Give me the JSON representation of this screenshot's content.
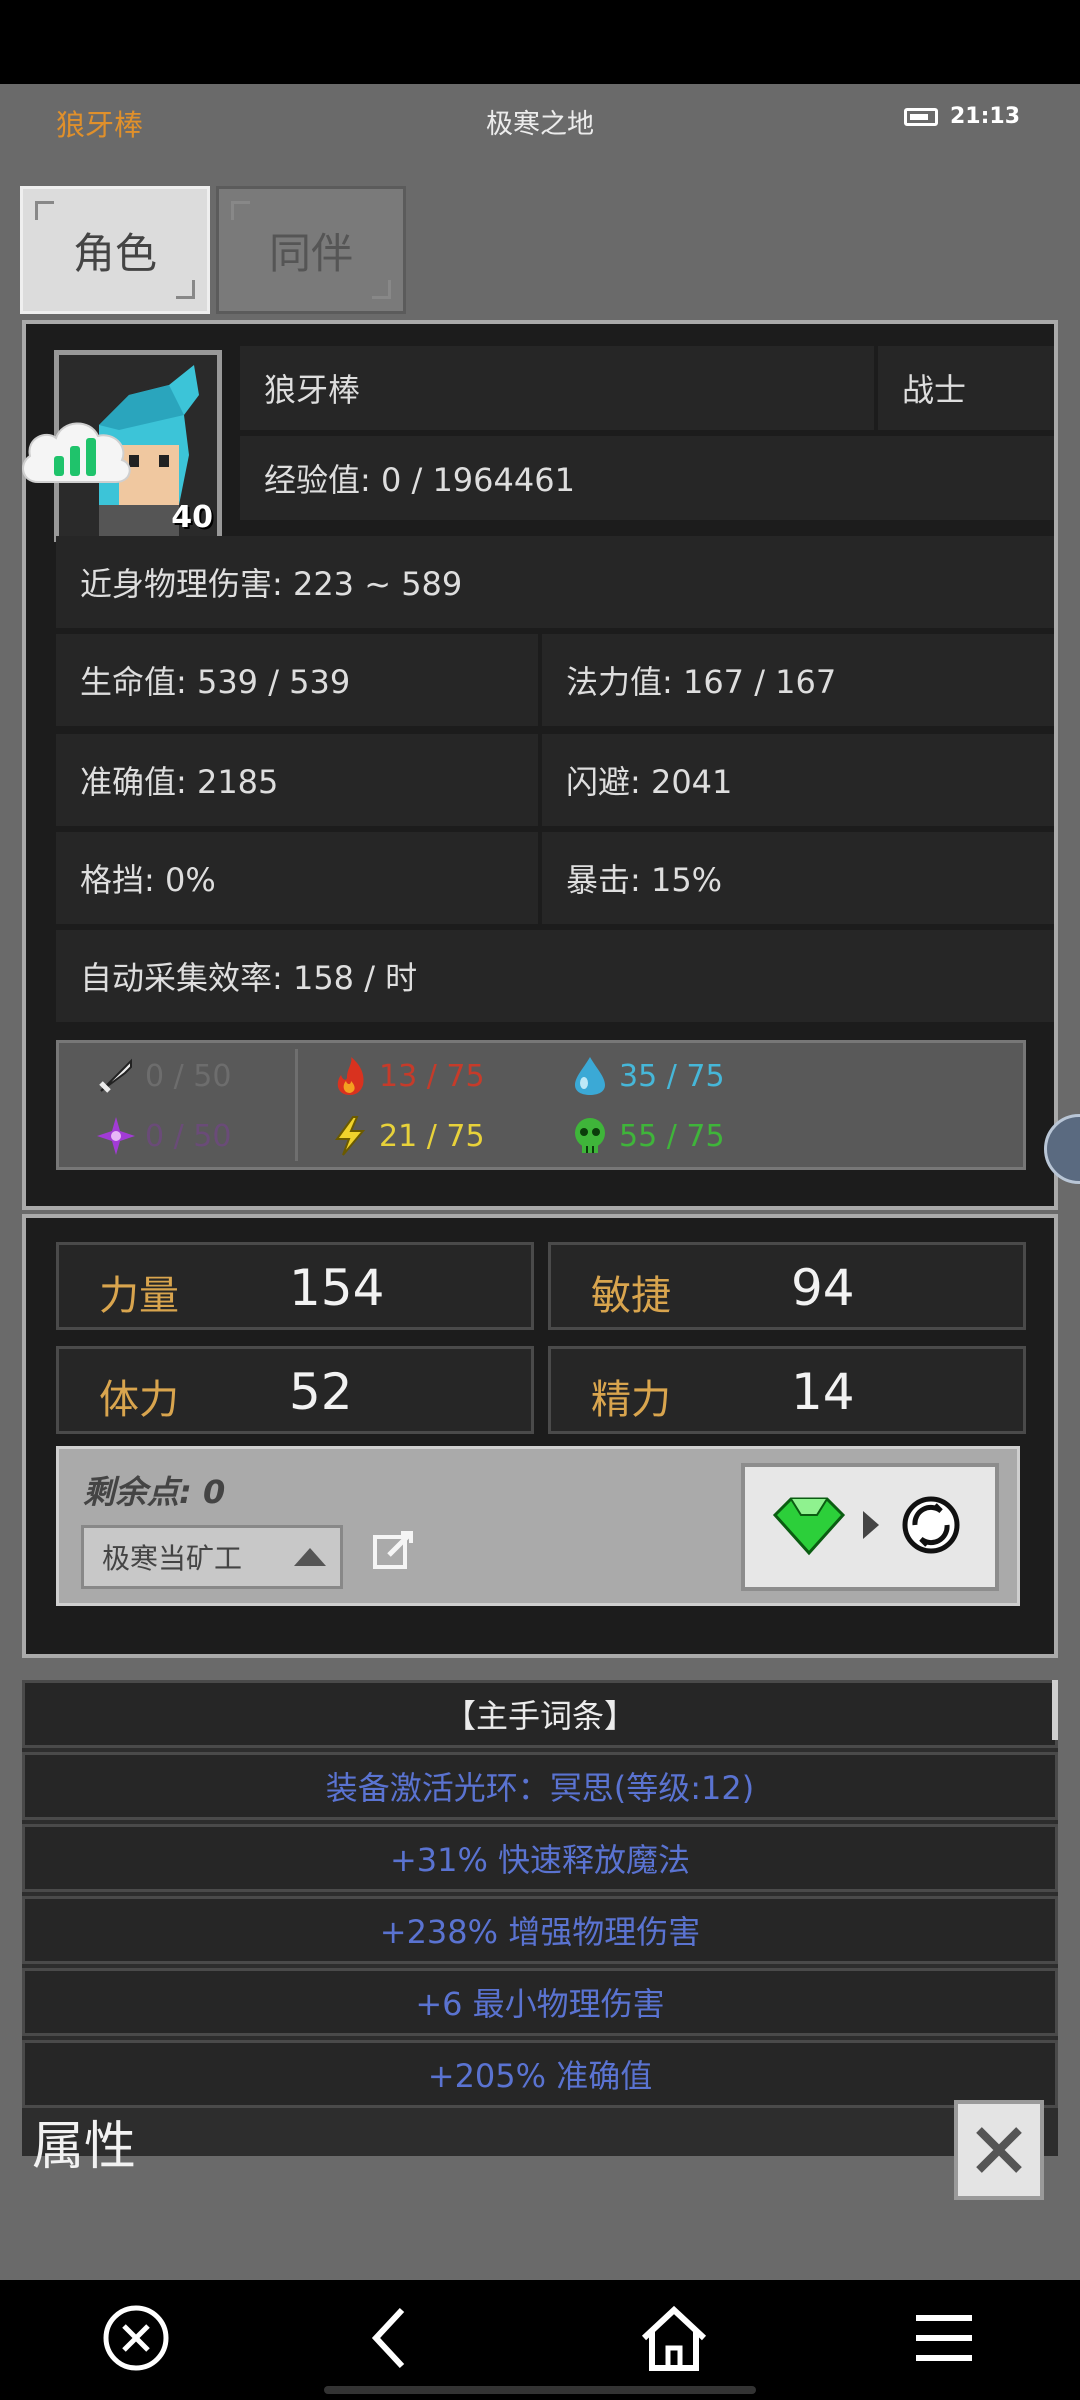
{
  "status_bar": {
    "weapon": "狼牙棒",
    "location": "极寒之地",
    "time": "21:13"
  },
  "tabs": [
    {
      "label": "角色",
      "active": true
    },
    {
      "label": "同伴",
      "active": false
    }
  ],
  "character": {
    "name": "狼牙棒",
    "class": "战士",
    "level": "40",
    "exp": "经验值: 0 / 1964461",
    "melee_damage": "近身物理伤害: 223 ~ 589",
    "hp": "生命值: 539 / 539",
    "mp": "法力值: 167 / 167",
    "accuracy": "准确值: 2185",
    "dodge": "闪避: 2041",
    "block": "格挡: 0%",
    "crit": "暴击: 15%",
    "gather_rate": "自动采集效率: 158 / 时"
  },
  "resistances": [
    {
      "icon": "sword-icon",
      "value": "0 / 50",
      "color": "#6d6d6d"
    },
    {
      "icon": "fire-icon",
      "value": "13 / 75",
      "color": "#c63b2a"
    },
    {
      "icon": "water-drop-icon",
      "value": "35 / 75",
      "color": "#46b7d9"
    },
    {
      "icon": "arcane-star-icon",
      "value": "0 / 50",
      "color": "#6a4b78"
    },
    {
      "icon": "lightning-icon",
      "value": "21 / 75",
      "color": "#e8d23a"
    },
    {
      "icon": "poison-skull-icon",
      "value": "55 / 75",
      "color": "#3fb53a"
    }
  ],
  "attributes": [
    {
      "label": "力量",
      "value": "154"
    },
    {
      "label": "敏捷",
      "value": "94"
    },
    {
      "label": "体力",
      "value": "52"
    },
    {
      "label": "精力",
      "value": "14"
    }
  ],
  "points": {
    "remaining": "剩余点: 0",
    "preset": "极寒当矿工"
  },
  "affixes": {
    "header": "【主手词条】",
    "items": [
      "装备激活光环：冥思(等级:12)",
      "+31% 快速释放魔法",
      "+238% 增强物理伤害",
      "+6 最小物理伤害",
      "+205% 准确值"
    ]
  },
  "footer": {
    "title": "属性"
  }
}
